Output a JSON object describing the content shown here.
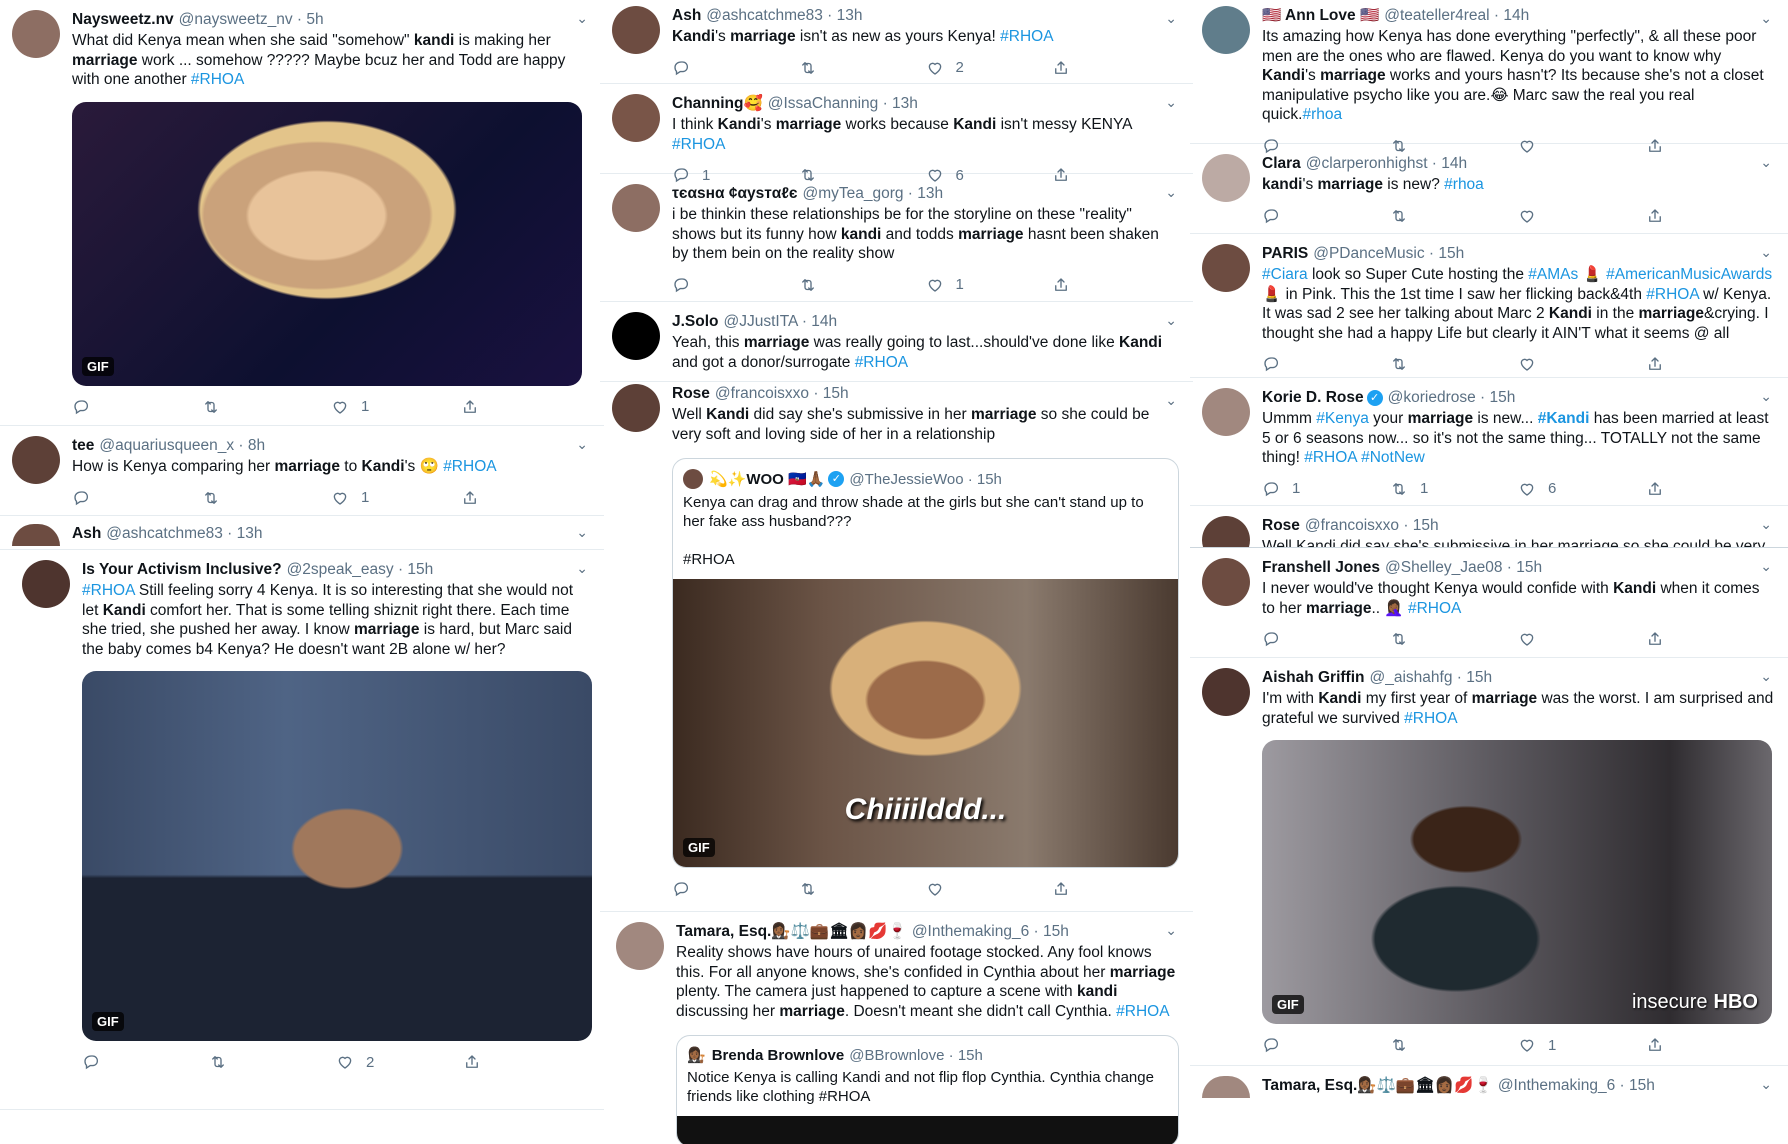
{
  "col1": {
    "t1": {
      "name": "Naysweetz.nv",
      "meta": "@naysweetz_nv · 5h",
      "text": "What did Kenya mean when she said  \"somehow\" ",
      "b1": "kandi",
      "text2": " is making her ",
      "b2": "marriage",
      "text3": " work ... somehow ????? Maybe bcuz her and Todd are happy with one another ",
      "tag": "#RHOA",
      "gif": "GIF",
      "likes": "1"
    },
    "t2": {
      "name": "tee",
      "meta": "@aquariusqueen_x · 8h",
      "text": "How is Kenya comparing her ",
      "b1": "marriage",
      "text2": " to ",
      "b2": "Kandi",
      "text3": "'s 🙄 ",
      "tag": "#RHOA",
      "likes": "1"
    },
    "t3": {
      "name": "Ash",
      "meta": "@ashcatchme83 · 13h"
    },
    "t4": {
      "name": "Is Your Activism Inclusive?",
      "meta": "@2speak_easy · 15h",
      "tag": "#RHOA",
      "text": " Still feeling sorry 4 Kenya. It is so interesting that she would not let ",
      "b1": "Kandi",
      "text2": " comfort her. That is some telling shiznit right there. Each time she tried, she pushed her away. I know ",
      "b2": "marriage",
      "text3": " is hard, but Marc said the baby comes b4 Kenya? He doesn't want 2B alone w/ her?",
      "gif": "GIF",
      "likes": "2"
    }
  },
  "col2": {
    "t1": {
      "name": "Ash",
      "meta": "@ashcatchme83 · 13h",
      "b1": "Kandi",
      "text": "'s ",
      "b2": "marriage",
      "text2": " isn't as new as yours Kenya! ",
      "tag": "#RHOA",
      "likes": "2"
    },
    "t2": {
      "name": "Channing🥰",
      "meta": "@IssaChanning · 13h",
      "text": "I think ",
      "b1": "Kandi",
      "text2": "'s ",
      "b2": "marriage",
      "text3": " works because ",
      "b3": "Kandi",
      "text4": " isn't messy KENYA ",
      "tag": "#RHOA",
      "replies": "1",
      "likes": "6"
    },
    "t3": {
      "name": "τєαѕнα ¢αуѕтαℓє",
      "meta": "@myTea_gorg · 13h",
      "text": "i be thinkin these relationships be for the storyline on these \"reality\" shows but its funny how ",
      "b1": "kandi",
      "text2": " and todds ",
      "b2": "marriage",
      "text3": " hasnt been shaken by them bein on the reality show",
      "likes": "1"
    },
    "t4": {
      "name": "J.Solo",
      "meta": "@JJustITA · 14h",
      "text": "Yeah, this ",
      "b1": "marriage",
      "text2": " was really going to last...should've done like ",
      "b2": "Kandi",
      "text3": " and got a donor/surrogate ",
      "tag": "#RHOA"
    },
    "t5": {
      "name": "Rose",
      "meta": "@francoisxxo · 15h",
      "text": "Well ",
      "b1": "Kandi",
      "text2": " did say she's submissive in her ",
      "b2": "marriage",
      "text3": " so she could be very soft and loving side of her in a relationship",
      "quote": {
        "name": "💫✨WOO 🇭🇹🙏🏾",
        "meta": "@TheJessieWoo · 15h",
        "text": "Kenya can drag and throw shade at the girls but she can't stand up to her fake ass husband???",
        "tag": "#RHOA",
        "caption": "Chiiiilddd...",
        "gif": "GIF"
      }
    },
    "t6": {
      "name": "Tamara, Esq.👩🏾‍⚖️⚖️💼🏛👩🏾💋🍷",
      "meta": "@Inthemaking_6 · 15h",
      "text": "Reality shows have hours of unaired footage stocked. Any fool knows this. For all anyone knows, she's confided in Cynthia about her ",
      "b1": "marriage",
      "text2": " plenty. The camera just happened to capture a scene with ",
      "b2": "kandi",
      "text3": " discussing her ",
      "b3": "marriage",
      "text4": ". Doesn't meant she didn't call Cynthia. ",
      "tag": "#RHOA",
      "quote": {
        "name": "Brenda Brownlove",
        "meta": "@BBrownlove · 15h",
        "text": "Notice Kenya is calling Kandi and not flip flop Cynthia. Cynthia change friends like clothing #RHOA"
      }
    }
  },
  "col3": {
    "t1": {
      "name": "🇺🇸 Ann Love 🇺🇸",
      "meta": "@teateller4real · 14h",
      "text": "Its amazing how Kenya has done everything \"perfectly\", & all these poor men are the ones who are flawed. Kenya do you want to know why ",
      "b1": "Kandi",
      "text2": "'s ",
      "b2": "marriage",
      "text3": " works and yours hasn't? Its because she's not a closet manipulative psycho like you are.😂 Marc saw the real you real quick.",
      "tag": "#rhoa"
    },
    "t2": {
      "name": "Clara",
      "meta": "@clarperonhighst · 14h",
      "b1": "kandi",
      "text": "'s ",
      "b2": "marriage",
      "text2": " is new? ",
      "tag": "#rhoa"
    },
    "t3": {
      "name": "PARIS",
      "meta": "@PDanceMusic · 15h",
      "tag1": "#Ciara",
      "text": " look so Super Cute  hosting the ",
      "tag2": "#AMAs",
      "text2": " 💄 ",
      "tag3": "#AmericanMusicAwards",
      "text3": " 💄 in Pink. This the 1st time I saw her flicking back&4th ",
      "tag4": "#RHOA",
      "text4": " w/ Kenya. It was sad 2 see her talking about Marc 2 ",
      "b1": "Kandi",
      "text5": " in the ",
      "b2": "marriage",
      "text6": "&crying. I thought she had a happy Life but clearly it AIN'T what it seems @ all"
    },
    "t4": {
      "name": "Korie D. Rose",
      "meta": "@koriedrose · 15h",
      "text": "Ummm ",
      "tag1": "#Kenya",
      "text2": " your ",
      "b1": "marriage",
      "text3": " is new... ",
      "tag2": "#Kandi",
      "text4": " has been married at least 5 or 6 seasons now... so it's not the same thing... TOTALLY not the same thing! ",
      "tag3": "#RHOA #NotNew",
      "replies": "1",
      "retweets": "1",
      "likes": "6"
    },
    "t5": {
      "name": "Rose",
      "meta": "@francoisxxo · 15h",
      "text": "Well Kandi did say she's submissive in her marriage so she could be very"
    },
    "t6": {
      "name": "Franshell Jones",
      "meta": "@Shelley_Jae08 · 15h",
      "text": "I never would've thought Kenya would confide with ",
      "b1": "Kandi",
      "text2": " when it comes to her ",
      "b2": "marriage",
      "text3": ".. 🤦🏾‍♀️ ",
      "tag": "#RHOA"
    },
    "t7": {
      "name": "Aishah Griffin",
      "meta": "@_aishahfg · 15h",
      "text": "I'm with ",
      "b1": "Kandi",
      "text2": " my first year of ",
      "b2": "marriage",
      "text3": " was the worst. I am surprised and grateful we survived ",
      "tag": "#RHOA",
      "gif": "GIF",
      "brand1": "insecure",
      "brand2": "HBO",
      "likes": "1"
    },
    "t8": {
      "name": "Tamara, Esq.👩🏾‍⚖️⚖️💼🏛👩🏾💋🍷",
      "meta": "@Inthemaking_6 · 15h"
    }
  }
}
